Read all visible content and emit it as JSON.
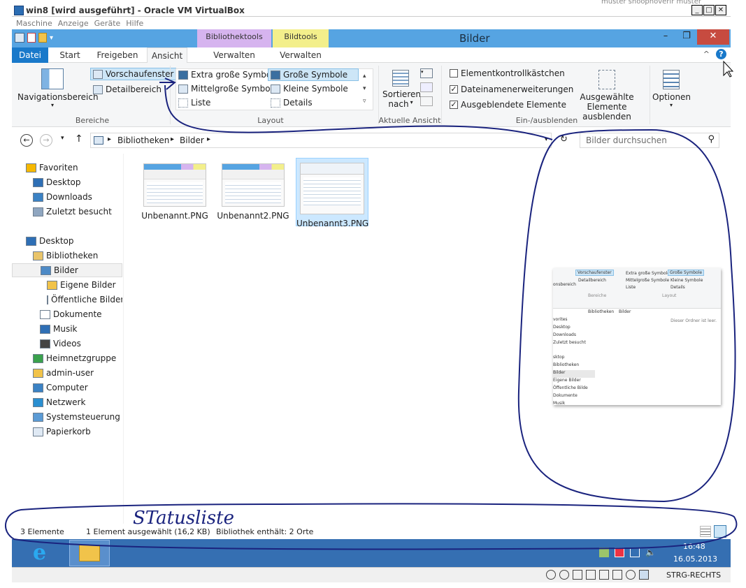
{
  "vbox": {
    "title": "win8 [wird ausgeführt] - Oracle VM VirtualBox",
    "menu": [
      "Maschine",
      "Anzeige",
      "Geräte",
      "Hilfe"
    ],
    "status_key": "STRG-RECHTS",
    "top_text": "muster  snoopnoverir  muster"
  },
  "explorer": {
    "title": "Bilder",
    "context_tab_groups": [
      "Bibliothektools",
      "Bildtools"
    ],
    "tabs": [
      "Datei",
      "Start",
      "Freigeben",
      "Ansicht",
      "Verwalten",
      "Verwalten"
    ],
    "ribbon": {
      "bereiche": {
        "nav_pane": "Navigationsbereich",
        "preview_pane": "Vorschaufenster",
        "details_pane": "Detailbereich",
        "label": "Bereiche"
      },
      "layout": {
        "items": [
          "Extra große Symbole",
          "Große Symbole",
          "Mittelgroße Symbole",
          "Kleine Symbole",
          "Liste",
          "Details"
        ],
        "selected": "Große Symbole",
        "label": "Layout"
      },
      "current_view": {
        "sort_line1": "Sortieren",
        "sort_line2": "nach",
        "label": "Aktuelle Ansicht"
      },
      "show_hide": {
        "checkboxes": [
          {
            "label": "Elementkontrollkästchen",
            "checked": false
          },
          {
            "label": "Dateinamenerweiterungen",
            "checked": true
          },
          {
            "label": "Ausgeblendete Elemente",
            "checked": true
          }
        ],
        "hide_selected_line1": "Ausgewählte",
        "hide_selected_line2": "Elemente ausblenden",
        "label": "Ein-/ausblenden"
      },
      "options": "Optionen"
    },
    "address": {
      "crumbs": [
        "Bibliotheken",
        "Bilder"
      ],
      "search_placeholder": "Bilder durchsuchen"
    },
    "nav": [
      {
        "label": "Favoriten",
        "icon": "star-icon",
        "indent": 0
      },
      {
        "label": "Desktop",
        "icon": "desktop-icon",
        "indent": 1
      },
      {
        "label": "Downloads",
        "icon": "downloads-icon",
        "indent": 1
      },
      {
        "label": "Zuletzt besucht",
        "icon": "recent-icon",
        "indent": 1
      },
      {
        "label": "Desktop",
        "icon": "desktop-icon",
        "indent": 0
      },
      {
        "label": "Bibliotheken",
        "icon": "library-icon",
        "indent": 1
      },
      {
        "label": "Bilder",
        "icon": "pictures-icon",
        "indent": 2,
        "selected": true
      },
      {
        "label": "Eigene Bilder",
        "icon": "folder-icon",
        "indent": 3
      },
      {
        "label": "Öffentliche Bilder",
        "icon": "folder-icon",
        "indent": 3
      },
      {
        "label": "Dokumente",
        "icon": "documents-icon",
        "indent": 2
      },
      {
        "label": "Musik",
        "icon": "music-icon",
        "indent": 2
      },
      {
        "label": "Videos",
        "icon": "videos-icon",
        "indent": 2
      },
      {
        "label": "Heimnetzgruppe",
        "icon": "homegroup-icon",
        "indent": 1
      },
      {
        "label": "admin-user",
        "icon": "user-folder-icon",
        "indent": 1
      },
      {
        "label": "Computer",
        "icon": "computer-icon",
        "indent": 1
      },
      {
        "label": "Netzwerk",
        "icon": "network-icon",
        "indent": 1
      },
      {
        "label": "Systemsteuerung",
        "icon": "control-panel-icon",
        "indent": 1
      },
      {
        "label": "Papierkorb",
        "icon": "recycle-bin-icon",
        "indent": 1
      }
    ],
    "files": [
      {
        "name": "Unbenannt.PNG",
        "selected": false
      },
      {
        "name": "Unbenannt2.PNG",
        "selected": false
      },
      {
        "name": "Unbenannt3.PNG",
        "selected": true
      }
    ],
    "preview": {
      "message": "Dieser Ordner ist leer.",
      "ribbon_items": [
        "Vorschaufenster",
        "Detailbereich",
        "Extra große Symbole",
        "Große Symbole",
        "Mittelgroße Symbole",
        "Kleine Symbole",
        "Liste",
        "Details"
      ],
      "ribbon_nav": "onsbereich",
      "group_labels": [
        "Bereiche",
        "Layout"
      ],
      "crumbs": [
        "Bibliotheken",
        "Bilder"
      ],
      "nav": [
        "vorites",
        "Desktop",
        "Downloads",
        "Zuletzt besucht",
        "sktop",
        "Bibliotheken",
        "Bilder",
        "Eigene Bilder",
        "Öffentliche Bilde",
        "Dokumente",
        "Musik"
      ]
    },
    "status": [
      "3 Elemente",
      "1 Element ausgewählt (16,2 KB)",
      "Bibliothek enthält: 2 Orte"
    ]
  },
  "taskbar": {
    "time": "16:48",
    "date": "16.05.2013"
  },
  "annotation": {
    "text": "STatusliste"
  },
  "colors": {
    "titlebar": "#56a4e2",
    "taskbar": "#356fb2",
    "datei_tab": "#1979ca",
    "ink": "#1a237e"
  }
}
